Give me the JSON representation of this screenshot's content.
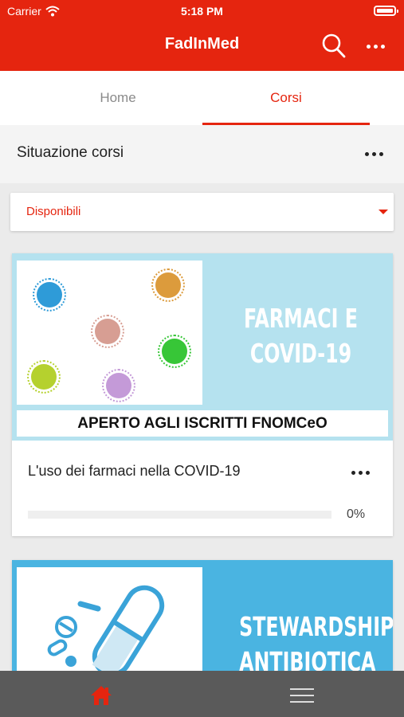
{
  "status_bar": {
    "carrier": "Carrier",
    "time": "5:18 PM"
  },
  "app_bar": {
    "title": "FadInMed",
    "icons": [
      "search-icon",
      "more-icon"
    ]
  },
  "tabs": [
    {
      "label": "Home",
      "selected": false
    },
    {
      "label": "Corsi",
      "selected": true
    }
  ],
  "section": {
    "title": "Situazione corsi"
  },
  "filter": {
    "selected": "Disponibili"
  },
  "courses": [
    {
      "banner_heading": "FARMACI E\nCOVID-19",
      "banner_caption": "APERTO AGLI ISCRITTI FNOMCeO",
      "title": "L'uso dei farmaci nella COVID-19",
      "progress_label": "0%",
      "progress": 0
    },
    {
      "banner_heading": "STEWARDSHIP\nANTIBIOTICA"
    }
  ],
  "bottom_nav": {
    "items": [
      "home-icon",
      "menu-icon"
    ]
  },
  "colors": {
    "accent": "#e5250f",
    "banner1": "#b5e2ef",
    "banner2": "#4ab4e1",
    "bottom_bar": "#5a5a5a"
  }
}
